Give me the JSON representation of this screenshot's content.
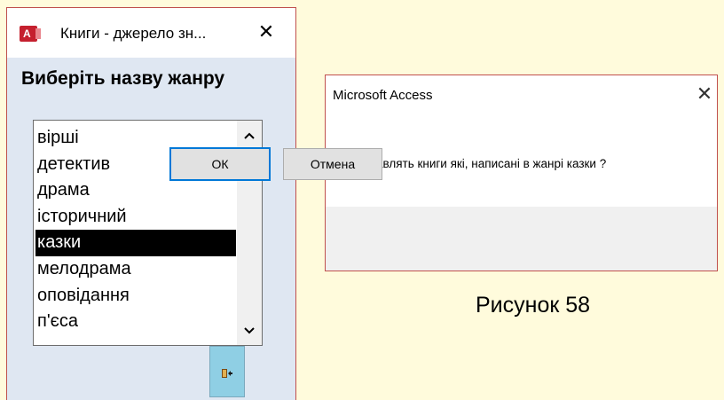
{
  "form": {
    "window_title": "Книги - джерело зн...",
    "app_icon_letter": "A",
    "close_glyph": "✕",
    "heading": "Виберіть назву жанру",
    "list": {
      "items": [
        "вірші",
        "детектив",
        "драма",
        "історичний",
        "казки",
        "мелодрама",
        "оповідання",
        "п'єса"
      ],
      "selected": "казки"
    },
    "scroll_up_glyph": "⌃",
    "scroll_down_glyph": "⌄",
    "exit_button_icon": "exit-door-icon"
  },
  "dialog": {
    "title": "Microsoft Access",
    "close_glyph": "✕",
    "message": "Вас цікавлять книги які, написані в жанрі казки ?",
    "ok_label": "ОК",
    "cancel_label": "Отмена"
  },
  "caption": "Рисунок 58",
  "colors": {
    "background": "#fffbdc",
    "window_border": "#c0504d",
    "form_background": "#dfe7f2",
    "selection": "#000000",
    "exit_button": "#8fcfe4",
    "access_red": "#c5202e",
    "focus_border": "#0078d7"
  }
}
